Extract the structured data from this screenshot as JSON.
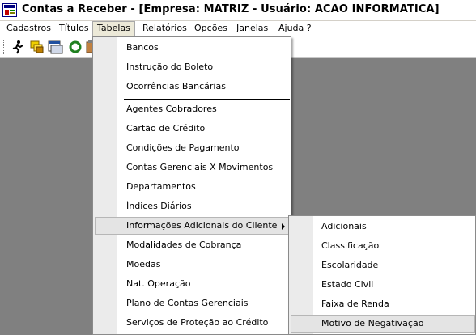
{
  "window": {
    "title": "Contas a Receber - [Empresa: MATRIZ - Usuário: ACAO INFORMATICA]"
  },
  "menubar": {
    "items": [
      "Cadastros",
      "Títulos",
      "Tabelas",
      "Relatórios",
      "Opções",
      "Janelas",
      "Ajuda ?"
    ],
    "active": "Tabelas"
  },
  "toolbar": {
    "icons": [
      "running-man-icon",
      "folders-icon",
      "window-icon",
      "refresh-icon",
      "clipboard-icon"
    ]
  },
  "tabelas_menu": {
    "items": [
      "Bancos",
      "Instrução do Boleto",
      "Ocorrências Bancárias",
      "Agentes Cobradores",
      "Cartão de Crédito",
      "Condições de Pagamento",
      "Contas Gerenciais X Movimentos",
      "Departamentos",
      "Índices Diários",
      "Informações Adicionais do Cliente",
      "Modalidades de Cobrança",
      "Moedas",
      "Nat. Operação",
      "Plano de Contas Gerenciais",
      "Serviços de Proteção ao Crédito"
    ],
    "highlighted": "Informações Adicionais do Cliente"
  },
  "submenu": {
    "items": [
      "Adicionais",
      "Classificação",
      "Escolaridade",
      "Estado Civil",
      "Faixa de Renda",
      "Motivo de Negativação"
    ],
    "highlighted": "Motivo de Negativação"
  }
}
